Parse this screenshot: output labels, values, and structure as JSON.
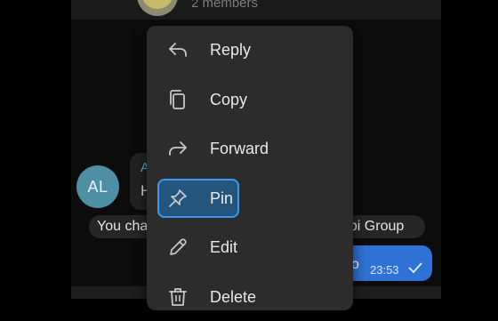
{
  "header": {
    "members": "2 members"
  },
  "chat": {
    "sender_initials": "AL",
    "incoming_name_partial": "A",
    "incoming_text_partial": "H",
    "system_left": "You cha",
    "system_right": "npi Group",
    "outgoing_text_partial": "o",
    "outgoing_time": "23:53"
  },
  "menu": {
    "items": [
      {
        "label": "Reply",
        "icon": "reply-icon"
      },
      {
        "label": "Copy",
        "icon": "copy-icon"
      },
      {
        "label": "Forward",
        "icon": "forward-icon"
      },
      {
        "label": "Pin",
        "icon": "pin-icon",
        "highlighted": true
      },
      {
        "label": "Edit",
        "icon": "pencil-icon"
      },
      {
        "label": "Delete",
        "icon": "trash-icon"
      }
    ]
  },
  "colors": {
    "accent": "#3b98ee",
    "outgoing_bubble": "#2f72d6",
    "menu_bg": "#2c2c2c",
    "avatar": "#4f8fa3",
    "sender_name": "#5bb7c8"
  }
}
